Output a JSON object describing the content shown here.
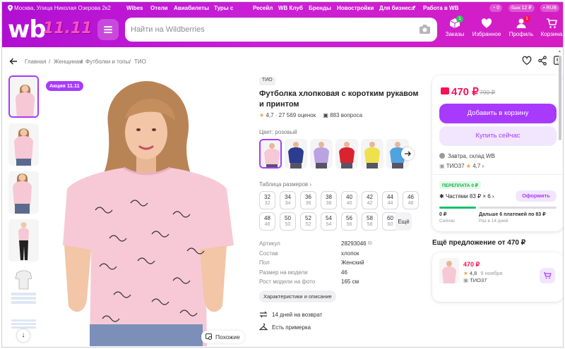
{
  "topbar": {
    "location": "Москва, Улица Николая Озерова 2к2",
    "nav": [
      "Wibes",
      "Отели",
      "Авиабилеты",
      "Туры с",
      "Ресейл",
      "WB Клуб",
      "Бренды",
      "Новостройки",
      "Для бизнеса",
      "Работа в WB"
    ],
    "wallet_balance": "0",
    "bank_label": "банк",
    "bank_amount": "12 ₽",
    "currency": "RUB"
  },
  "logo": {
    "wb": "wb",
    "sale": "11.11"
  },
  "search": {
    "placeholder": "Найти на Wildberries"
  },
  "header_icons": [
    {
      "label": "Заказы",
      "badge": "1",
      "icon": "orders-icon"
    },
    {
      "label": "Избранное",
      "badge": "",
      "icon": "heart-icon"
    },
    {
      "label": "Профиль",
      "badge": "1",
      "icon": "profile-icon"
    },
    {
      "label": "Корзина",
      "badge": "",
      "icon": "cart-icon"
    }
  ],
  "breadcrumbs": [
    "Главная",
    "/",
    "Женщинам",
    "/",
    "Футболки и топы",
    "/",
    "ТИО"
  ],
  "gallery": {
    "promo": "Акция 11.11",
    "similar": "Похожие"
  },
  "product": {
    "brand": "ТИО",
    "title": "Футболка хлопковая с коротким рукавом и принтом",
    "rating": "4,7",
    "reviews": "27 569 оценок",
    "questions": "883 вопроса",
    "color_label": "Цвет: розовый",
    "swatch_colors": [
      "#f6c7d4",
      "#2c3d8f",
      "#b9a3e3",
      "#d9242f",
      "#efe14c",
      "#4fa4e0"
    ],
    "size_table": "Таблица размеров",
    "sizes_row1": [
      [
        "32",
        "32"
      ],
      [
        "34",
        "34"
      ],
      [
        "36",
        "36"
      ],
      [
        "38",
        "38"
      ],
      [
        "40",
        "40"
      ],
      [
        "42",
        "42"
      ],
      [
        "44",
        "44"
      ],
      [
        "46",
        "46"
      ]
    ],
    "sizes_row2": [
      [
        "48",
        "48"
      ],
      [
        "50",
        "50"
      ],
      [
        "52",
        "52"
      ],
      [
        "54",
        "54"
      ],
      [
        "56",
        "56"
      ],
      [
        "58",
        "58"
      ],
      [
        "60",
        "60"
      ]
    ],
    "sizes_more": "Ещё",
    "specs": [
      {
        "k": "Артикул",
        "v": "28293046"
      },
      {
        "k": "Состав",
        "v": "хлопок"
      },
      {
        "k": "Пол",
        "v": "Женский"
      },
      {
        "k": "Размер на модели",
        "v": "46"
      },
      {
        "k": "Рост модели на фото",
        "v": "165 см"
      }
    ],
    "chars_button": "Характеристики и описание",
    "return_days": "14 дней на возврат",
    "fitting": "Есть примерка"
  },
  "buy": {
    "price": "470 ₽",
    "old_price": "790 ₽",
    "add_to_cart": "Добавить в корзину",
    "buy_now": "Купить сейчас",
    "delivery": "Завтра, склад WB",
    "seller": "ТИО37",
    "seller_rating": "4,7",
    "overpay": "ПЕРЕПЛАТА 0 ₽",
    "parts": "Частями 83 ₽ × 6",
    "pay_button": "Оформить",
    "pay_now_amount": "0 ₽",
    "pay_now_label": "Сейчас",
    "pay_later_amount": "Дальше 6 платежей по 83 ₽",
    "pay_later_label": "Раз в 14 дней"
  },
  "more": {
    "title": "Ещё предложение от 470 ₽",
    "price": "470 ₽",
    "rating": "4,8",
    "date": "9 ноября",
    "seller": "ТИО37"
  },
  "colors": {
    "accent": "#a73afd",
    "price": "#f91155",
    "header": "#c91fd6",
    "star": "#ff9a3c"
  }
}
